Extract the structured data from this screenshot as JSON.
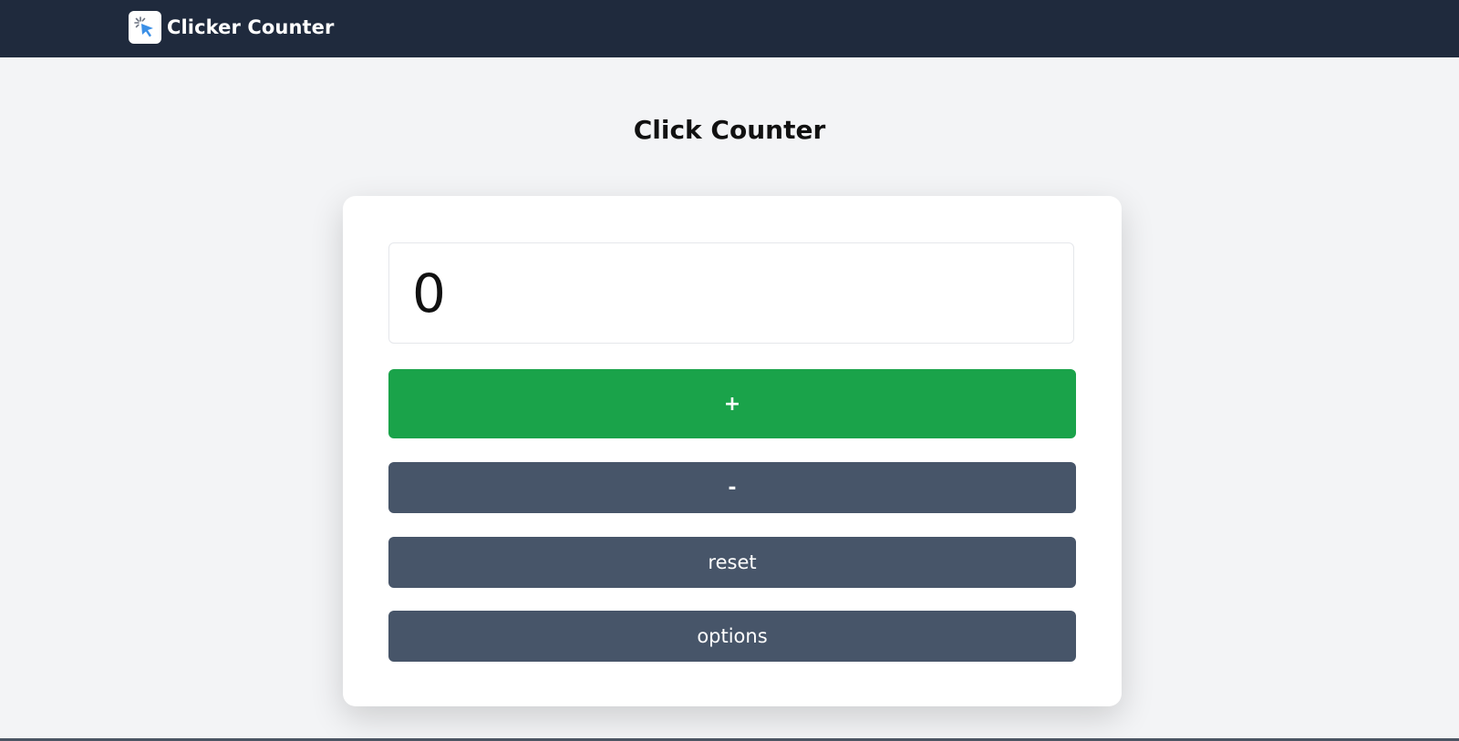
{
  "header": {
    "app_name": "Clicker Counter",
    "logo_icon": "cursor-click-icon",
    "background_color": "#1f2a3d"
  },
  "main": {
    "title": "Click Counter"
  },
  "counter": {
    "value": "0",
    "increment_label": "+",
    "decrement_label": "-",
    "reset_label": "reset",
    "options_label": "options",
    "increment_color": "#1aa34a",
    "secondary_color": "#475569"
  }
}
